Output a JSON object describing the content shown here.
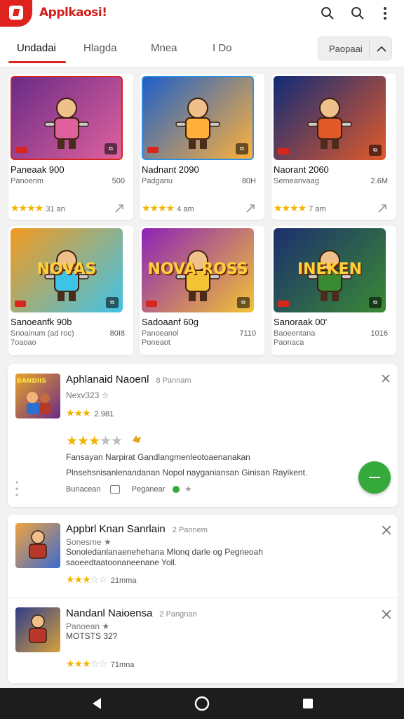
{
  "app": {
    "title": "Applkaosi!"
  },
  "header_icons": [
    "search-icon",
    "search-icon",
    "more-vertical-icon"
  ],
  "tabs": [
    {
      "label": "Undadai",
      "active": true
    },
    {
      "label": "Hlagda",
      "active": false
    },
    {
      "label": "Mnea",
      "active": false
    },
    {
      "label": "I Do",
      "active": false
    }
  ],
  "tab_button": {
    "label": "Paopaai"
  },
  "cards": [
    {
      "title": "Paneaak 900",
      "sub": "Panoenm",
      "sub2": "",
      "size": "500",
      "rating": "★★★★",
      "count": "31 an",
      "thumb_text": "",
      "colors": [
        "#6a2b86",
        "#e0619e"
      ]
    },
    {
      "title": "Nadnant 2090",
      "sub": "Padganu",
      "sub2": "",
      "size": "80H",
      "rating": "★★★★",
      "count": "4 am",
      "thumb_text": "",
      "colors": [
        "#1d5fc9",
        "#ffb13b"
      ]
    },
    {
      "title": "Naorant 2060",
      "sub": "Semeanvaag",
      "sub2": "",
      "size": "2.6M",
      "rating": "★★★★",
      "count": "7 am",
      "thumb_text": "",
      "colors": [
        "#0e2b78",
        "#e35a2a"
      ]
    },
    {
      "title": "Sanoeanfk 90b",
      "sub": "Snoainum (ad roc)",
      "sub2": "7oaoao",
      "size": "80I8",
      "rating": "",
      "count": "",
      "thumb_text": "NOVAS",
      "colors": [
        "#f39a1e",
        "#3ec3e8"
      ]
    },
    {
      "title": "Sadoaanf 60g",
      "sub": "Panoeanol",
      "sub2": "Poneaot",
      "size": "7110",
      "rating": "",
      "count": "",
      "thumb_text": "NOVA ROSS",
      "colors": [
        "#8c22b8",
        "#f2c335"
      ]
    },
    {
      "title": "Sanoraak 00'",
      "sub": "Baoeentana",
      "sub2": "Paonaca",
      "size": "1016",
      "rating": "",
      "count": "",
      "thumb_text": "INEKEN",
      "colors": [
        "#1c2e6e",
        "#3a8a34"
      ]
    }
  ],
  "featured": {
    "title": "Aphlanaid Naoenl",
    "count": "8 Pannam",
    "meta": "Nexv323 ☆",
    "stars_small": "★★★",
    "stars_small_count": "2.981",
    "stars_big": "★★★",
    "stars_big_empty": "★★",
    "line1": "Fansayan Narpirat Gandlangmenleotoaenanakan",
    "line2": "Plnsehsnisanlenandanan Nopol nayganiansan Ginisan Rayikent.",
    "footer_a": "Bunacean",
    "footer_b": "Peganear",
    "icon_text": "BANDIIS"
  },
  "list": [
    {
      "title": "Appbrl Knan Sanrlain",
      "count": "2 Pannem",
      "meta": "Sonesme ★",
      "desc_a": "Sonoledanlanaenehehana Mlonq darle og Pegneoah",
      "desc_b": "saoeedtaatoonaneenane Yoll.",
      "stars": "★★★",
      "stars_empty": "☆☆",
      "count2": "21mma"
    },
    {
      "title": "Nandanl Naioensa",
      "count": "2 Pangnan",
      "meta": "Panoean ★",
      "desc_a": "MOTSTS 32?",
      "desc_b": "",
      "stars": "★★★",
      "stars_empty": "☆☆",
      "count2": "71mna"
    }
  ],
  "nav": [
    "back-icon",
    "home-icon",
    "recents-icon"
  ]
}
